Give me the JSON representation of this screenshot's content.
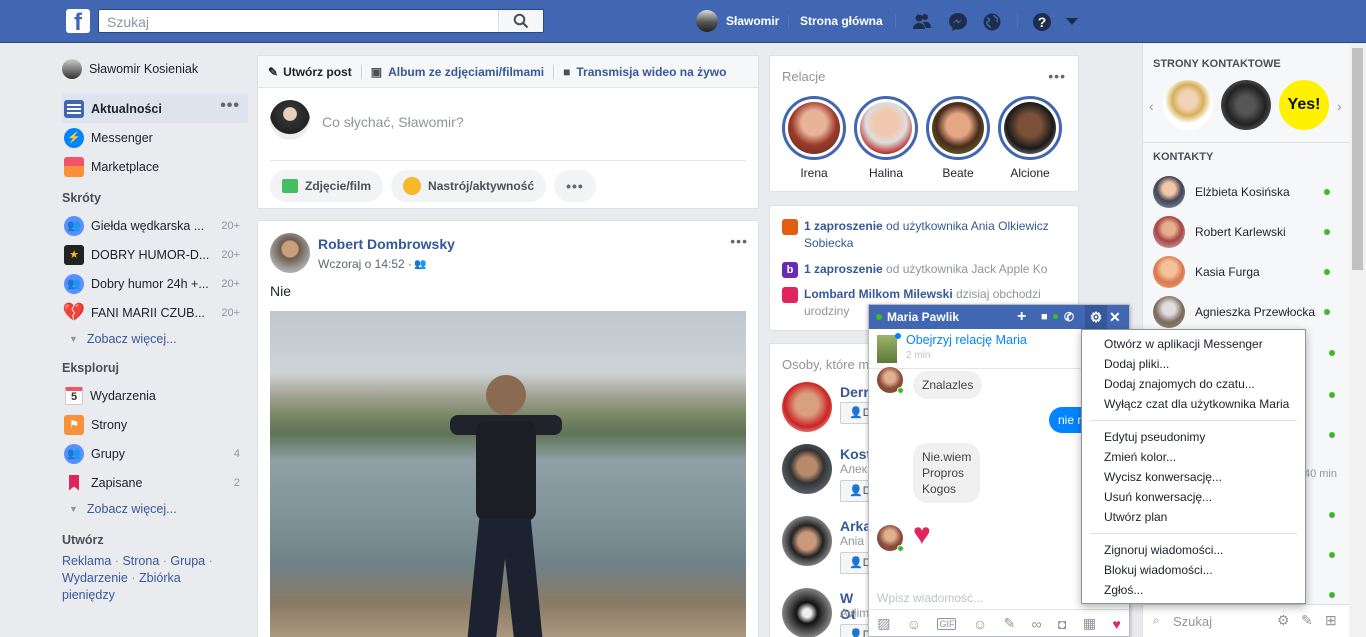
{
  "topbar": {
    "logo": "f",
    "search_placeholder": "Szukaj",
    "user": "Sławomir",
    "home": "Strona główna"
  },
  "left": {
    "user": "Sławomir Kosieniak",
    "items": [
      {
        "label": "Aktualności"
      },
      {
        "label": "Messenger"
      },
      {
        "label": "Marketplace"
      }
    ],
    "shortcuts_title": "Skróty",
    "shortcuts": [
      {
        "label": "Giełda wędkarska ...",
        "count": "20+"
      },
      {
        "label": "DOBRY HUMOR-D...",
        "count": "20+"
      },
      {
        "label": "Dobry humor 24h +...",
        "count": "20+"
      },
      {
        "label": "FANI MARII CZUB...",
        "count": "20+"
      }
    ],
    "see_more": "Zobacz więcej...",
    "explore_title": "Eksploruj",
    "explore": [
      {
        "label": "Wydarzenia",
        "count": "",
        "icon_text": "5"
      },
      {
        "label": "Strony",
        "count": ""
      },
      {
        "label": "Grupy",
        "count": "4"
      },
      {
        "label": "Zapisane",
        "count": "2"
      }
    ],
    "see_more2": "Zobacz więcej...",
    "create_title": "Utwórz",
    "create_links": [
      "Reklama",
      "Strona",
      "Grupa",
      "Wydarzenie",
      "Zbiórka pieniędzy"
    ]
  },
  "composer": {
    "tabs": [
      "Utwórz post",
      "Album ze zdjęciami/filmami",
      "Transmisja wideo na żywo"
    ],
    "placeholder": "Co słychać, Sławomir?",
    "actions": [
      "Zdjęcie/film",
      "Nastrój/aktywność"
    ]
  },
  "post": {
    "author": "Robert Dombrowsky",
    "time": "Wczoraj o 14:52 · ",
    "text": "Nie"
  },
  "stories": {
    "title": "Relacje",
    "people": [
      "Irena",
      "Halina",
      "Beate",
      "Alcione"
    ]
  },
  "notifications": [
    {
      "bold": "1 zaproszenie",
      "rest": " od użytkownika Ania Olkiewicz Sobiecka"
    },
    {
      "bold": "1 zaproszenie",
      "rest": " od użytkownika Jack Apple Ko"
    },
    {
      "bold": "Lombard Milkom Milewski",
      "rest": " dzisiaj obchodzi urodziny"
    }
  ],
  "pymk": {
    "title": "Osoby, które m",
    "people": [
      {
        "name": "Derri",
        "sub": ""
      },
      {
        "name": "Kost",
        "sub": "Алек"
      },
      {
        "name": "Arka",
        "sub": "Ania"
      },
      {
        "name": "W Ot",
        "sub": "Avlim"
      }
    ],
    "add_label": "D"
  },
  "right": {
    "pages_title": "STRONY KONTAKTOWE",
    "yes_label": "Yes!",
    "contacts_title": "KONTAKTY",
    "contacts": [
      {
        "name": "Elżbieta Kosińska"
      },
      {
        "name": "Robert Karlewski"
      },
      {
        "name": "Kasia Furga"
      },
      {
        "name": "Agnieszka Przewłocka"
      }
    ],
    "idle": "40 min",
    "search_placeholder": "Szukaj"
  },
  "chat": {
    "name": "Maria Pawlik",
    "story_link": "Obejrzyj relację Maria",
    "story_time": "2 min",
    "msg1": "Znalazles",
    "msg_out": "nie n",
    "msg2": [
      "Nie.wiem",
      "Propros",
      "Kogos"
    ],
    "input_placeholder": "Wpisz wiadomość..."
  },
  "menu": {
    "group1": [
      "Otwórz w aplikacji Messenger",
      "Dodaj pliki...",
      "Dodaj znajomych do czatu...",
      "Wyłącz czat dla użytkownika Maria"
    ],
    "group2": [
      "Edytuj pseudonimy",
      "Zmień kolor...",
      "Wycisz konwersację...",
      "Usuń konwersację...",
      "Utwórz plan"
    ],
    "group3": [
      "Zignoruj wiadomości...",
      "Blokuj wiadomości...",
      "Zgłoś..."
    ]
  }
}
